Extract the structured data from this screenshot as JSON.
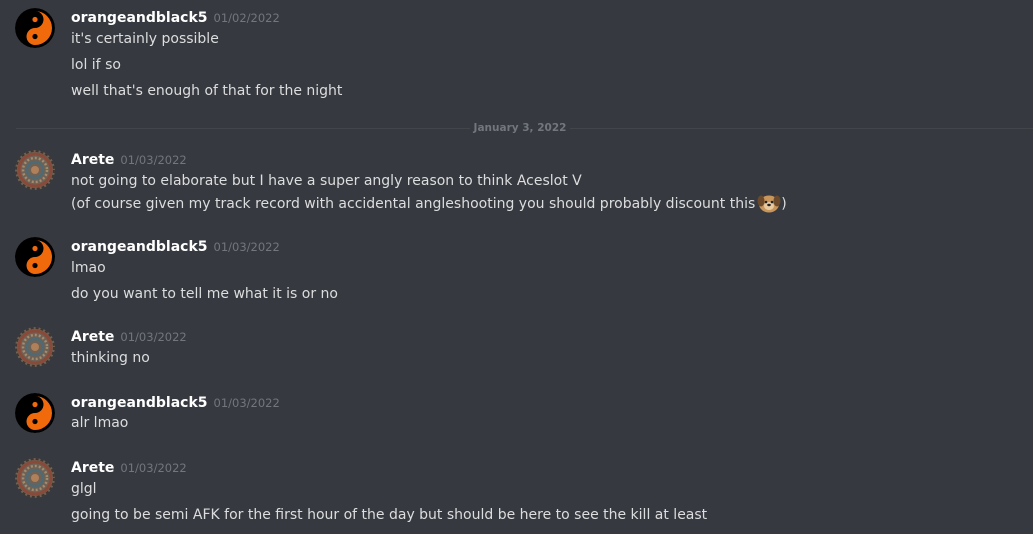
{
  "date_divider": "January 3, 2022",
  "groups": [
    {
      "avatar": "yin-yang-avatar",
      "author": "orangeandblack5",
      "timestamp": "01/02/2022",
      "lines": [
        "it's certainly possible",
        "lol if so",
        "well that's enough of that for the night"
      ]
    },
    {
      "avatar": "mandala-avatar",
      "author": "Arete",
      "timestamp": "01/03/2022",
      "lines": [
        "not going to elaborate but I have a super angly reason to think Aceslot V",
        "(of course given my track record with accidental angleshooting you should probably discount this",
        ")"
      ],
      "emoji": "dog-emoji"
    },
    {
      "avatar": "yin-yang-avatar",
      "author": "orangeandblack5",
      "timestamp": "01/03/2022",
      "lines": [
        "lmao",
        "do you want to tell me what it is or no"
      ]
    },
    {
      "avatar": "mandala-avatar",
      "author": "Arete",
      "timestamp": "01/03/2022",
      "lines": [
        "thinking no"
      ]
    },
    {
      "avatar": "yin-yang-avatar",
      "author": "orangeandblack5",
      "timestamp": "01/03/2022",
      "lines": [
        "alr lmao"
      ]
    },
    {
      "avatar": "mandala-avatar",
      "author": "Arete",
      "timestamp": "01/03/2022",
      "lines": [
        "glgl",
        "going to be semi AFK for the first hour of the day but should be here to see the kill at least"
      ]
    }
  ]
}
